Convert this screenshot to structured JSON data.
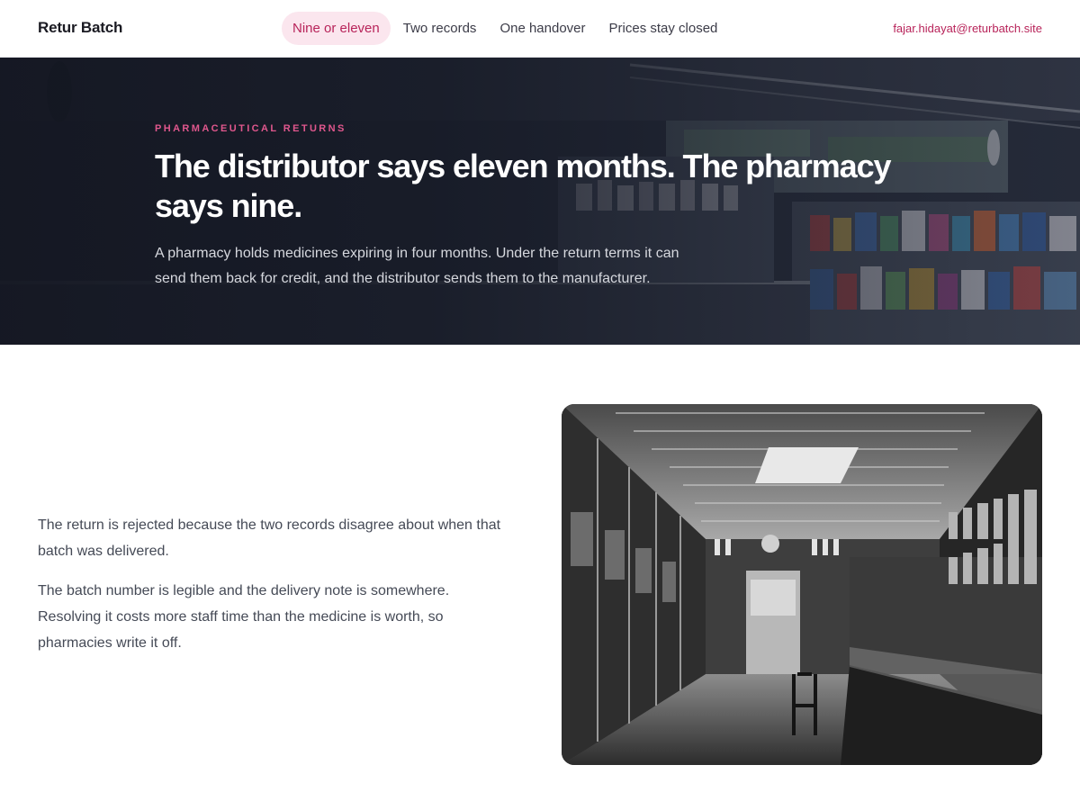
{
  "nav": {
    "brand": "Retur Batch",
    "links": [
      "Nine or eleven",
      "Two records",
      "One handover",
      "Prices stay closed"
    ],
    "active_index": 0,
    "email": "fajar.hidayat@returbatch.site"
  },
  "hero": {
    "eyebrow": "PHARMACEUTICAL RETURNS",
    "title": "The distributor says eleven months. The pharmacy says nine.",
    "lede": "A pharmacy holds medicines expiring in four months. Under the return terms it can send them back for credit, and the distributor sends them to the manufacturer."
  },
  "body": {
    "paragraphs": [
      "The return is rejected because the two records disagree about when that batch was delivered.",
      "The batch number is legible and the delivery note is somewhere. Resolving it costs more staff time than the medicine is worth, so pharmacies write it off."
    ]
  },
  "colors": {
    "accent": "#b8245a",
    "accent_soft": "#fbe6ee",
    "eyebrow": "#e0578d",
    "hero_bg": "#1d2230"
  }
}
